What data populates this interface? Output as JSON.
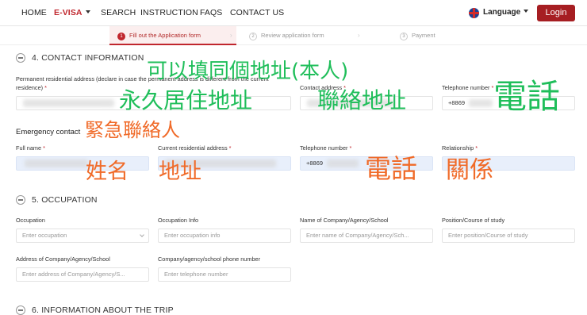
{
  "nav": {
    "items": [
      "HOME",
      "E-VISA",
      "SEARCH",
      "INSTRUCTION",
      "FAQS",
      "CONTACT US"
    ],
    "language": "Language",
    "login": "Login"
  },
  "steps": {
    "s1": {
      "num": "1",
      "label": "Fill out the Application form"
    },
    "s2": {
      "num": "2",
      "label": "Review application form"
    },
    "s3": {
      "num": "3",
      "label": "Payment"
    }
  },
  "contact": {
    "title": "4. CONTACT INFORMATION",
    "permanent_label": "Permanent residential address (declare in case the permanent address is different from the current residence)",
    "contact_address_label": "Contact address",
    "telephone_label": "Telephone number",
    "telephone_value": "+8869",
    "emergency_title": "Emergency contact",
    "full_name_label": "Full name",
    "current_address_label": "Current residential address",
    "emergency_phone_label": "Telephone number",
    "emergency_phone_value": "+8869",
    "relationship_label": "Relationship"
  },
  "occupation": {
    "title": "5. OCCUPATION",
    "occupation_label": "Occupation",
    "occupation_placeholder": "Enter occupation",
    "info_label": "Occupation Info",
    "info_placeholder": "Enter occupation info",
    "company_label": "Name of Company/Agency/School",
    "company_placeholder": "Enter name of Company/Agency/Sch...",
    "position_label": "Position/Course of study",
    "position_placeholder": "Enter position/Course of study",
    "address_label": "Address of Company/Agency/School",
    "address_placeholder": "Enter address of Company/Agency/S...",
    "phone_label": "Company/agency/school phone number",
    "phone_placeholder": "Enter telephone number"
  },
  "trip": {
    "title": "6. INFORMATION ABOUT THE TRIP"
  },
  "annotations": {
    "same_address": "可以填同個地址(本人)",
    "permanent": "永久居住地址",
    "contact": "聯絡地址",
    "phone": "電話",
    "emergency": "緊急聯絡人",
    "name": "姓名",
    "address": "地址",
    "phone2": "電話",
    "relation": "關係"
  }
}
